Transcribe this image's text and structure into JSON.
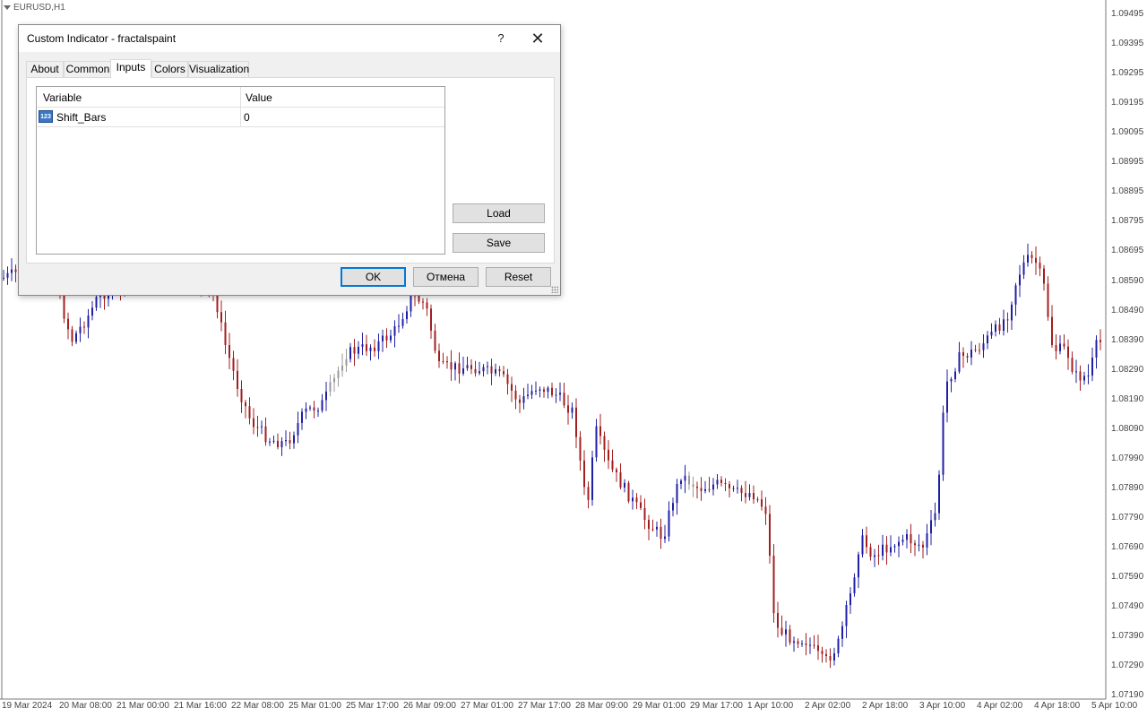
{
  "chart": {
    "symbol_label": "EURUSD,H1",
    "colors": {
      "bull": "#1f1fa6",
      "bear": "#a31f1f",
      "neutral": "#9a9a9a"
    },
    "price_axis": [
      "1.09495",
      "1.09395",
      "1.09295",
      "1.09195",
      "1.09095",
      "1.08995",
      "1.08895",
      "1.08795",
      "1.08695",
      "1.08590",
      "1.08490",
      "1.08390",
      "1.08290",
      "1.08190",
      "1.08090",
      "1.07990",
      "1.07890",
      "1.07790",
      "1.07690",
      "1.07590",
      "1.07490",
      "1.07390",
      "1.07290",
      "1.07190"
    ],
    "time_axis": [
      "19 Mar 2024",
      "20 Mar 08:00",
      "21 Mar 00:00",
      "21 Mar 16:00",
      "22 Mar 08:00",
      "25 Mar 01:00",
      "25 Mar 17:00",
      "26 Mar 09:00",
      "27 Mar 01:00",
      "27 Mar 17:00",
      "28 Mar 09:00",
      "29 Mar 01:00",
      "29 Mar 17:00",
      "1 Apr 10:00",
      "2 Apr 02:00",
      "2 Apr 18:00",
      "3 Apr 10:00",
      "4 Apr 02:00",
      "4 Apr 18:00",
      "5 Apr 10:00"
    ]
  },
  "dialog": {
    "title": "Custom Indicator - fractalspaint",
    "help_label": "?",
    "close_label": "✕",
    "tabs": [
      {
        "label": "About"
      },
      {
        "label": "Common"
      },
      {
        "label": "Inputs"
      },
      {
        "label": "Colors"
      },
      {
        "label": "Visualization"
      }
    ],
    "active_tab": "Inputs",
    "grid": {
      "headers": {
        "variable": "Variable",
        "value": "Value"
      },
      "rows": [
        {
          "icon": "integer-param-icon",
          "icon_text": "123",
          "variable": "Shift_Bars",
          "value": "0"
        }
      ]
    },
    "buttons": {
      "load": "Load",
      "save": "Save",
      "ok": "OK",
      "cancel": "Отмена",
      "reset": "Reset"
    }
  }
}
